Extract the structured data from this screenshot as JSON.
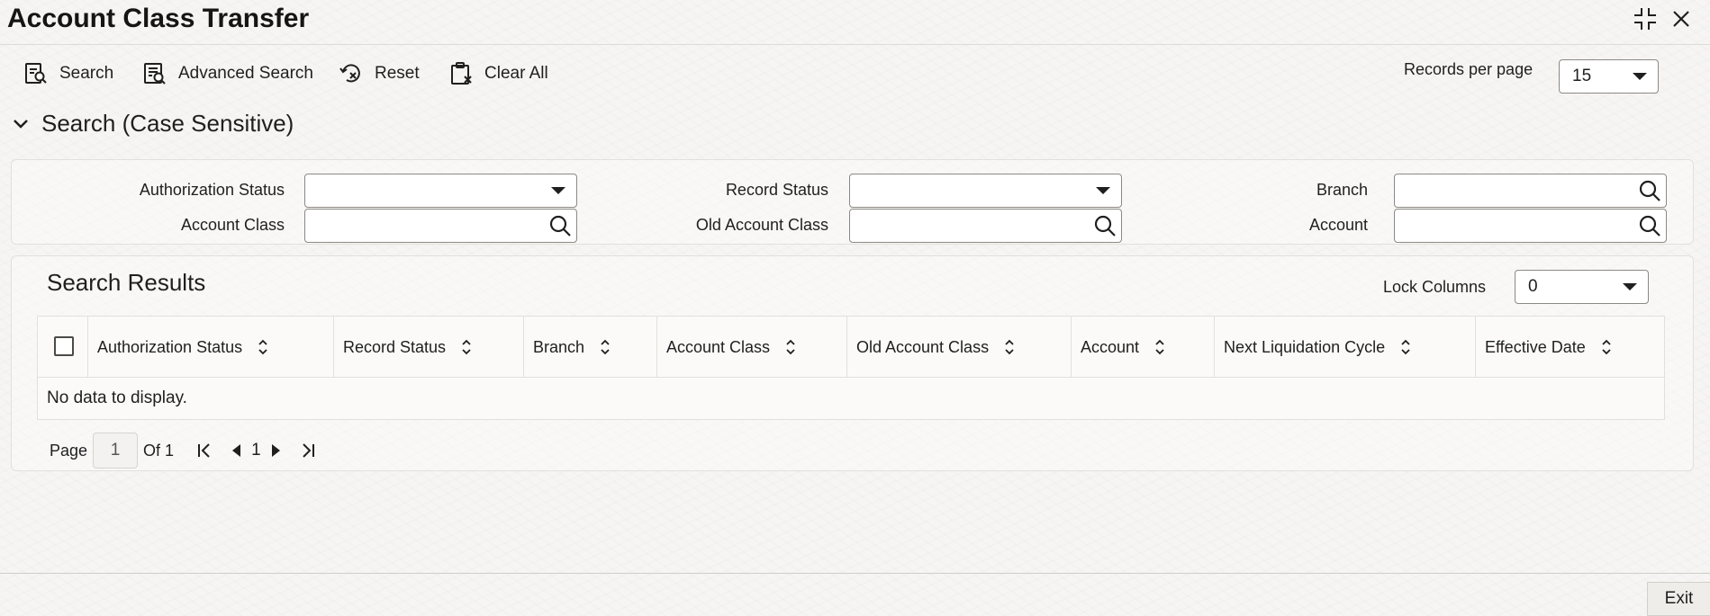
{
  "window": {
    "title": "Account Class Transfer",
    "icons": {
      "maximize": "maximize-icon",
      "close": "close-icon"
    }
  },
  "toolbar": {
    "search_label": "Search",
    "advanced_search_label": "Advanced Search",
    "reset_label": "Reset",
    "clear_all_label": "Clear All",
    "records_per_page_label": "Records per page",
    "records_per_page_value": "15"
  },
  "search_section": {
    "title": "Search (Case Sensitive)",
    "fields": {
      "authorization_status": {
        "label": "Authorization Status",
        "value": ""
      },
      "record_status": {
        "label": "Record Status",
        "value": ""
      },
      "branch": {
        "label": "Branch",
        "value": ""
      },
      "account_class": {
        "label": "Account Class",
        "value": ""
      },
      "old_account_class": {
        "label": "Old Account Class",
        "value": ""
      },
      "account": {
        "label": "Account",
        "value": ""
      }
    }
  },
  "results": {
    "title": "Search Results",
    "lock_columns_label": "Lock Columns",
    "lock_columns_value": "0",
    "columns": [
      "Authorization Status",
      "Record Status",
      "Branch",
      "Account Class",
      "Old Account Class",
      "Account",
      "Next Liquidation Cycle",
      "Effective Date"
    ],
    "rows": [],
    "empty_message": "No data to display."
  },
  "pagination": {
    "page_label": "Page",
    "current_page": "1",
    "of_label": "Of 1",
    "page_number": "1"
  },
  "footer": {
    "exit_label": "Exit"
  }
}
